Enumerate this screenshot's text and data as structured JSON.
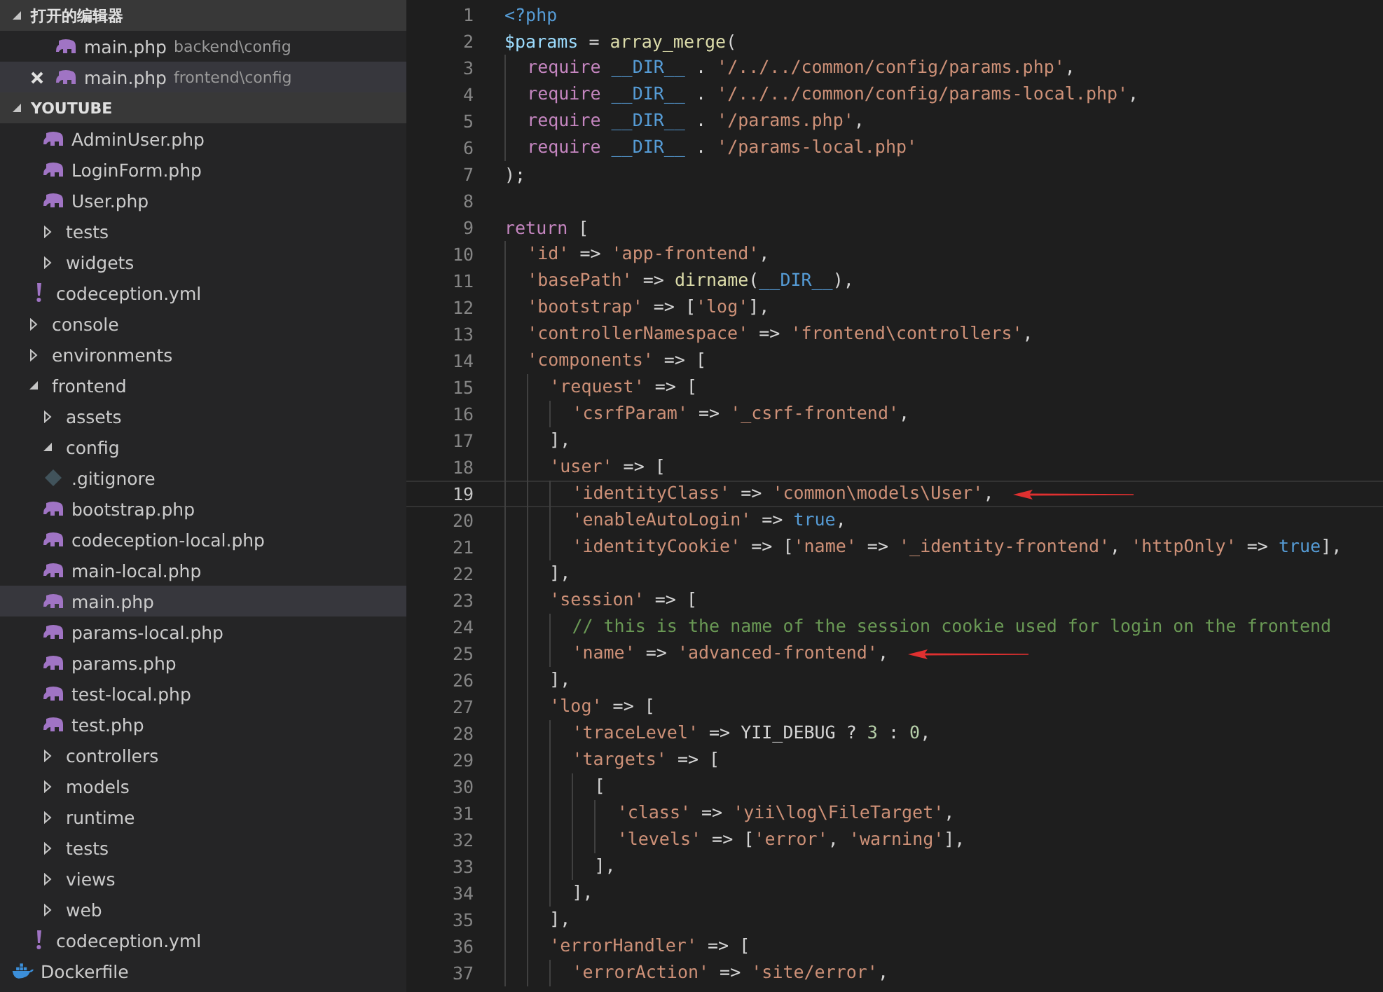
{
  "sidebar": {
    "open_editors": {
      "title": "打开的编辑器",
      "expanded": true,
      "items": [
        {
          "name": "main.php",
          "path": "backend\\config",
          "selected": false
        },
        {
          "name": "main.php",
          "path": "frontend\\config",
          "selected": true
        }
      ]
    },
    "project": {
      "title": "YOUTUBE",
      "expanded": true,
      "tree": [
        {
          "kind": "hidden",
          "children": [
            {
              "kind": "hidden",
              "children": [
                {
                  "kind": "php",
                  "name": "AdminUser.php",
                  "selected": false
                },
                {
                  "kind": "php",
                  "name": "LoginForm.php",
                  "selected": false
                },
                {
                  "kind": "php",
                  "name": "User.php",
                  "selected": false
                }
              ]
            },
            {
              "kind": "folder",
              "name": "tests",
              "expanded": false,
              "selected": false
            },
            {
              "kind": "folder",
              "name": "widgets",
              "expanded": false,
              "selected": false
            },
            {
              "kind": "yaml",
              "name": "codeception.yml",
              "selected": false
            }
          ]
        },
        {
          "kind": "folder",
          "name": "console",
          "expanded": false,
          "selected": false
        },
        {
          "kind": "folder",
          "name": "environments",
          "expanded": false,
          "selected": false
        },
        {
          "kind": "folder",
          "name": "frontend",
          "expanded": true,
          "selected": false,
          "children": [
            {
              "kind": "folder",
              "name": "assets",
              "expanded": false,
              "selected": false
            },
            {
              "kind": "folder",
              "name": "config",
              "expanded": true,
              "selected": false,
              "children": [
                {
                  "kind": "git",
                  "name": ".gitignore",
                  "selected": false
                },
                {
                  "kind": "php",
                  "name": "bootstrap.php",
                  "selected": false
                },
                {
                  "kind": "php",
                  "name": "codeception-local.php",
                  "selected": false
                },
                {
                  "kind": "php",
                  "name": "main-local.php",
                  "selected": false
                },
                {
                  "kind": "php",
                  "name": "main.php",
                  "selected": true
                },
                {
                  "kind": "php",
                  "name": "params-local.php",
                  "selected": false
                },
                {
                  "kind": "php",
                  "name": "params.php",
                  "selected": false
                },
                {
                  "kind": "php",
                  "name": "test-local.php",
                  "selected": false
                },
                {
                  "kind": "php",
                  "name": "test.php",
                  "selected": false
                }
              ]
            },
            {
              "kind": "folder",
              "name": "controllers",
              "expanded": false,
              "selected": false
            },
            {
              "kind": "folder",
              "name": "models",
              "expanded": false,
              "selected": false
            },
            {
              "kind": "folder",
              "name": "runtime",
              "expanded": false,
              "selected": false
            },
            {
              "kind": "folder",
              "name": "tests",
              "expanded": false,
              "selected": false
            },
            {
              "kind": "folder",
              "name": "views",
              "expanded": false,
              "selected": false
            },
            {
              "kind": "folder",
              "name": "web",
              "expanded": false,
              "selected": false
            },
            {
              "kind": "yaml",
              "name": "codeception.yml",
              "selected": false
            }
          ]
        },
        {
          "kind": "docker",
          "name": "Dockerfile",
          "selected": false
        }
      ]
    }
  },
  "editor": {
    "lines": [
      {
        "n": "1",
        "current": false,
        "annotated": false,
        "tokens": [
          {
            "kind": "constant",
            "text": "<?php"
          }
        ]
      },
      {
        "n": "2",
        "current": false,
        "annotated": false,
        "tokens": [
          {
            "kind": "variable",
            "text": "$params"
          },
          {
            "kind": "plain",
            "text": " = "
          },
          {
            "kind": "function",
            "text": "array_merge"
          },
          {
            "kind": "plain",
            "text": "("
          }
        ]
      },
      {
        "n": "3",
        "current": false,
        "annotated": false,
        "tokens": [
          {
            "kind": "keyword",
            "text": "  require"
          },
          {
            "kind": "constant",
            "text": " __DIR__"
          },
          {
            "kind": "plain",
            "text": " . "
          },
          {
            "kind": "string",
            "text": "'/../../common/config/params.php'"
          },
          {
            "kind": "plain",
            "text": ","
          }
        ]
      },
      {
        "n": "4",
        "current": false,
        "annotated": false,
        "tokens": [
          {
            "kind": "keyword",
            "text": "  require"
          },
          {
            "kind": "constant",
            "text": " __DIR__"
          },
          {
            "kind": "plain",
            "text": " . "
          },
          {
            "kind": "string",
            "text": "'/../../common/config/params-local.php'"
          },
          {
            "kind": "plain",
            "text": ","
          }
        ]
      },
      {
        "n": "5",
        "current": false,
        "annotated": false,
        "tokens": [
          {
            "kind": "keyword",
            "text": "  require"
          },
          {
            "kind": "constant",
            "text": " __DIR__"
          },
          {
            "kind": "plain",
            "text": " . "
          },
          {
            "kind": "string",
            "text": "'/params.php'"
          },
          {
            "kind": "plain",
            "text": ","
          }
        ]
      },
      {
        "n": "6",
        "current": false,
        "annotated": false,
        "tokens": [
          {
            "kind": "keyword",
            "text": "  require"
          },
          {
            "kind": "constant",
            "text": " __DIR__"
          },
          {
            "kind": "plain",
            "text": " . "
          },
          {
            "kind": "string",
            "text": "'/params-local.php'"
          }
        ]
      },
      {
        "n": "7",
        "current": false,
        "annotated": false,
        "tokens": [
          {
            "kind": "plain",
            "text": ");"
          }
        ]
      },
      {
        "n": "8",
        "current": false,
        "annotated": false
      },
      {
        "n": "9",
        "current": false,
        "annotated": false,
        "tokens": [
          {
            "kind": "keyword",
            "text": "return"
          },
          {
            "kind": "plain",
            "text": " ["
          }
        ]
      },
      {
        "n": "10",
        "current": false,
        "annotated": false,
        "tokens": [
          {
            "kind": "string",
            "text": "  'id'"
          },
          {
            "kind": "plain",
            "text": " => "
          },
          {
            "kind": "string",
            "text": "'app-frontend'"
          },
          {
            "kind": "plain",
            "text": ","
          }
        ]
      },
      {
        "n": "11",
        "current": false,
        "annotated": false,
        "tokens": [
          {
            "kind": "string",
            "text": "  'basePath'"
          },
          {
            "kind": "plain",
            "text": " => "
          },
          {
            "kind": "function",
            "text": "dirname"
          },
          {
            "kind": "plain",
            "text": "("
          },
          {
            "kind": "constant",
            "text": "__DIR__"
          },
          {
            "kind": "plain",
            "text": "),"
          }
        ]
      },
      {
        "n": "12",
        "current": false,
        "annotated": false,
        "tokens": [
          {
            "kind": "string",
            "text": "  'bootstrap'"
          },
          {
            "kind": "plain",
            "text": " => ["
          },
          {
            "kind": "string",
            "text": "'log'"
          },
          {
            "kind": "plain",
            "text": "],"
          }
        ]
      },
      {
        "n": "13",
        "current": false,
        "annotated": false,
        "tokens": [
          {
            "kind": "string",
            "text": "  'controllerNamespace'"
          },
          {
            "kind": "plain",
            "text": " => "
          },
          {
            "kind": "string",
            "text": "'frontend\\controllers'"
          },
          {
            "kind": "plain",
            "text": ","
          }
        ]
      },
      {
        "n": "14",
        "current": false,
        "annotated": false,
        "tokens": [
          {
            "kind": "string",
            "text": "  'components'"
          },
          {
            "kind": "plain",
            "text": " => ["
          }
        ]
      },
      {
        "n": "15",
        "current": false,
        "annotated": false,
        "tokens": [
          {
            "kind": "string",
            "text": "    'request'"
          },
          {
            "kind": "plain",
            "text": " => ["
          }
        ]
      },
      {
        "n": "16",
        "current": false,
        "annotated": false,
        "tokens": [
          {
            "kind": "string",
            "text": "      'csrfParam'"
          },
          {
            "kind": "plain",
            "text": " => "
          },
          {
            "kind": "string",
            "text": "'_csrf-frontend'"
          },
          {
            "kind": "plain",
            "text": ","
          }
        ]
      },
      {
        "n": "17",
        "current": false,
        "annotated": false,
        "tokens": [
          {
            "kind": "plain",
            "text": "    ],"
          }
        ]
      },
      {
        "n": "18",
        "current": false,
        "annotated": false,
        "tokens": [
          {
            "kind": "string",
            "text": "    'user'"
          },
          {
            "kind": "plain",
            "text": " => ["
          }
        ]
      },
      {
        "n": "19",
        "current": true,
        "annotated": true,
        "tokens": [
          {
            "kind": "string",
            "text": "      'identityClass'"
          },
          {
            "kind": "plain",
            "text": " => "
          },
          {
            "kind": "string",
            "text": "'common\\models\\User'"
          },
          {
            "kind": "plain",
            "text": ","
          }
        ]
      },
      {
        "n": "20",
        "current": false,
        "annotated": false,
        "tokens": [
          {
            "kind": "string",
            "text": "      'enableAutoLogin'"
          },
          {
            "kind": "plain",
            "text": " => "
          },
          {
            "kind": "constant",
            "text": "true"
          },
          {
            "kind": "plain",
            "text": ","
          }
        ]
      },
      {
        "n": "21",
        "current": false,
        "annotated": false,
        "tokens": [
          {
            "kind": "string",
            "text": "      'identityCookie'"
          },
          {
            "kind": "plain",
            "text": " => ["
          },
          {
            "kind": "string",
            "text": "'name'"
          },
          {
            "kind": "plain",
            "text": " => "
          },
          {
            "kind": "string",
            "text": "'_identity-frontend'"
          },
          {
            "kind": "plain",
            "text": ", "
          },
          {
            "kind": "string",
            "text": "'httpOnly'"
          },
          {
            "kind": "plain",
            "text": " => "
          },
          {
            "kind": "constant",
            "text": "true"
          },
          {
            "kind": "plain",
            "text": "],"
          }
        ]
      },
      {
        "n": "22",
        "current": false,
        "annotated": false,
        "tokens": [
          {
            "kind": "plain",
            "text": "    ],"
          }
        ]
      },
      {
        "n": "23",
        "current": false,
        "annotated": false,
        "tokens": [
          {
            "kind": "string",
            "text": "    'session'"
          },
          {
            "kind": "plain",
            "text": " => ["
          }
        ]
      },
      {
        "n": "24",
        "current": false,
        "annotated": false,
        "tokens": [
          {
            "kind": "comment",
            "text": "      // this is the name of the session cookie used for login on the frontend"
          }
        ]
      },
      {
        "n": "25",
        "current": false,
        "annotated": true,
        "tokens": [
          {
            "kind": "string",
            "text": "      'name'"
          },
          {
            "kind": "plain",
            "text": " => "
          },
          {
            "kind": "string",
            "text": "'advanced-frontend'"
          },
          {
            "kind": "plain",
            "text": ","
          }
        ]
      },
      {
        "n": "26",
        "current": false,
        "annotated": false,
        "tokens": [
          {
            "kind": "plain",
            "text": "    ],"
          }
        ]
      },
      {
        "n": "27",
        "current": false,
        "annotated": false,
        "tokens": [
          {
            "kind": "string",
            "text": "    'log'"
          },
          {
            "kind": "plain",
            "text": " => ["
          }
        ]
      },
      {
        "n": "28",
        "current": false,
        "annotated": false,
        "tokens": [
          {
            "kind": "string",
            "text": "      'traceLevel'"
          },
          {
            "kind": "plain",
            "text": " => YII_DEBUG ? "
          },
          {
            "kind": "number",
            "text": "3"
          },
          {
            "kind": "plain",
            "text": " : "
          },
          {
            "kind": "number",
            "text": "0"
          },
          {
            "kind": "plain",
            "text": ","
          }
        ]
      },
      {
        "n": "29",
        "current": false,
        "annotated": false,
        "tokens": [
          {
            "kind": "string",
            "text": "      'targets'"
          },
          {
            "kind": "plain",
            "text": " => ["
          }
        ]
      },
      {
        "n": "30",
        "current": false,
        "annotated": false,
        "tokens": [
          {
            "kind": "plain",
            "text": "        ["
          }
        ]
      },
      {
        "n": "31",
        "current": false,
        "annotated": false,
        "tokens": [
          {
            "kind": "string",
            "text": "          'class'"
          },
          {
            "kind": "plain",
            "text": " => "
          },
          {
            "kind": "string",
            "text": "'yii\\log\\FileTarget'"
          },
          {
            "kind": "plain",
            "text": ","
          }
        ]
      },
      {
        "n": "32",
        "current": false,
        "annotated": false,
        "tokens": [
          {
            "kind": "string",
            "text": "          'levels'"
          },
          {
            "kind": "plain",
            "text": " => ["
          },
          {
            "kind": "string",
            "text": "'error'"
          },
          {
            "kind": "plain",
            "text": ", "
          },
          {
            "kind": "string",
            "text": "'warning'"
          },
          {
            "kind": "plain",
            "text": "],"
          }
        ]
      },
      {
        "n": "33",
        "current": false,
        "annotated": false,
        "tokens": [
          {
            "kind": "plain",
            "text": "        ],"
          }
        ]
      },
      {
        "n": "34",
        "current": false,
        "annotated": false,
        "tokens": [
          {
            "kind": "plain",
            "text": "      ],"
          }
        ]
      },
      {
        "n": "35",
        "current": false,
        "annotated": false,
        "tokens": [
          {
            "kind": "plain",
            "text": "    ],"
          }
        ]
      },
      {
        "n": "36",
        "current": false,
        "annotated": false,
        "tokens": [
          {
            "kind": "string",
            "text": "    'errorHandler'"
          },
          {
            "kind": "plain",
            "text": " => ["
          }
        ]
      },
      {
        "n": "37",
        "current": false,
        "annotated": false,
        "tokens": [
          {
            "kind": "string",
            "text": "      'errorAction'"
          },
          {
            "kind": "plain",
            "text": " => "
          },
          {
            "kind": "string",
            "text": "'site/error'"
          },
          {
            "kind": "plain",
            "text": ","
          }
        ]
      }
    ]
  }
}
